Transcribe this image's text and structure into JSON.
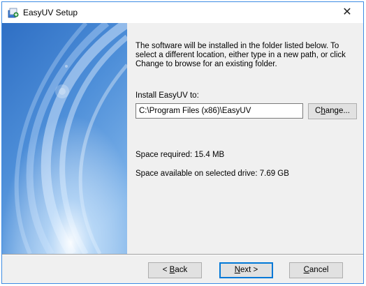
{
  "window": {
    "title": "EasyUV Setup",
    "close_glyph": "✕"
  },
  "main": {
    "description": "The software will be installed in the folder listed below. To select a different location, either type in a new path, or click Change to browse for an existing folder.",
    "install_label": "Install EasyUV to:",
    "install_path": "C:\\Program Files (x86)\\EasyUV",
    "change_button": {
      "pre": "C",
      "key": "h",
      "post": "ange..."
    },
    "space_required": "Space required: 15.4 MB",
    "space_available": "Space available on selected drive: 7.69 GB"
  },
  "footer": {
    "back_button": {
      "pre": "< ",
      "key": "B",
      "post": "ack"
    },
    "next_button": {
      "pre": "",
      "key": "N",
      "post": "ext >"
    },
    "cancel_button": {
      "pre": "",
      "key": "C",
      "post": "ancel"
    }
  },
  "colors": {
    "accent": "#0078d7",
    "window_border": "#3d8be3",
    "side_panel": "#5a9bdf"
  },
  "icons": {
    "app": "installer-icon",
    "close": "close-icon"
  }
}
